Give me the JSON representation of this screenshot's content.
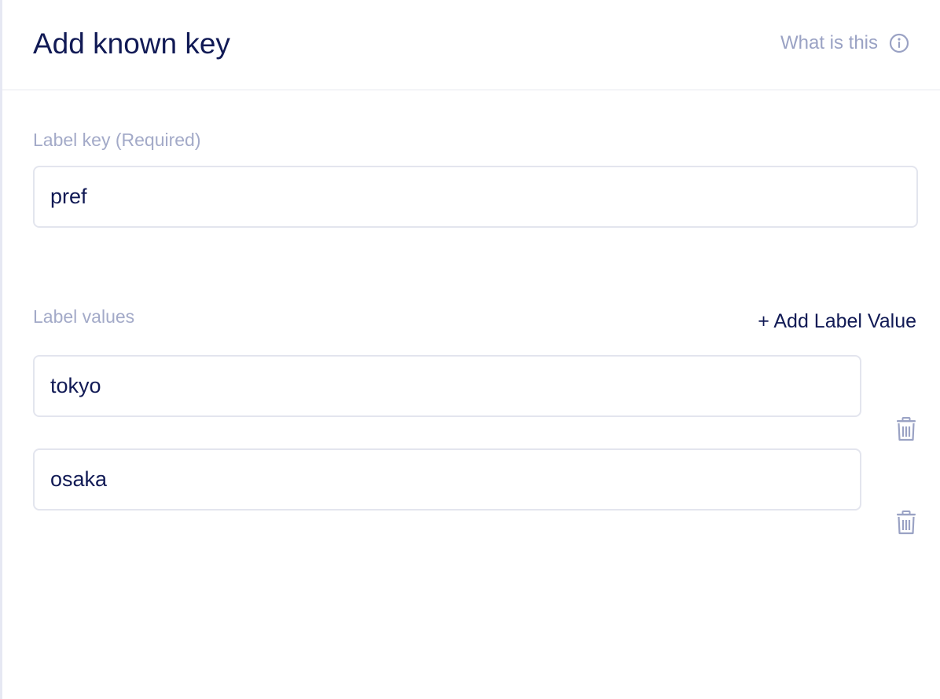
{
  "header": {
    "title": "Add known key",
    "help_label": "What is this"
  },
  "label_key": {
    "label": "Label key (Required)",
    "value": "pref"
  },
  "label_values": {
    "label": "Label values",
    "add_label": "+ Add Label Value",
    "items": [
      {
        "value": "tokyo"
      },
      {
        "value": "osaka"
      }
    ]
  },
  "icons": {
    "help": "info-circle-icon",
    "delete": "trash-icon"
  },
  "colors": {
    "title": "#111a55",
    "muted": "#9aa2c4",
    "border": "#e3e5ee"
  }
}
